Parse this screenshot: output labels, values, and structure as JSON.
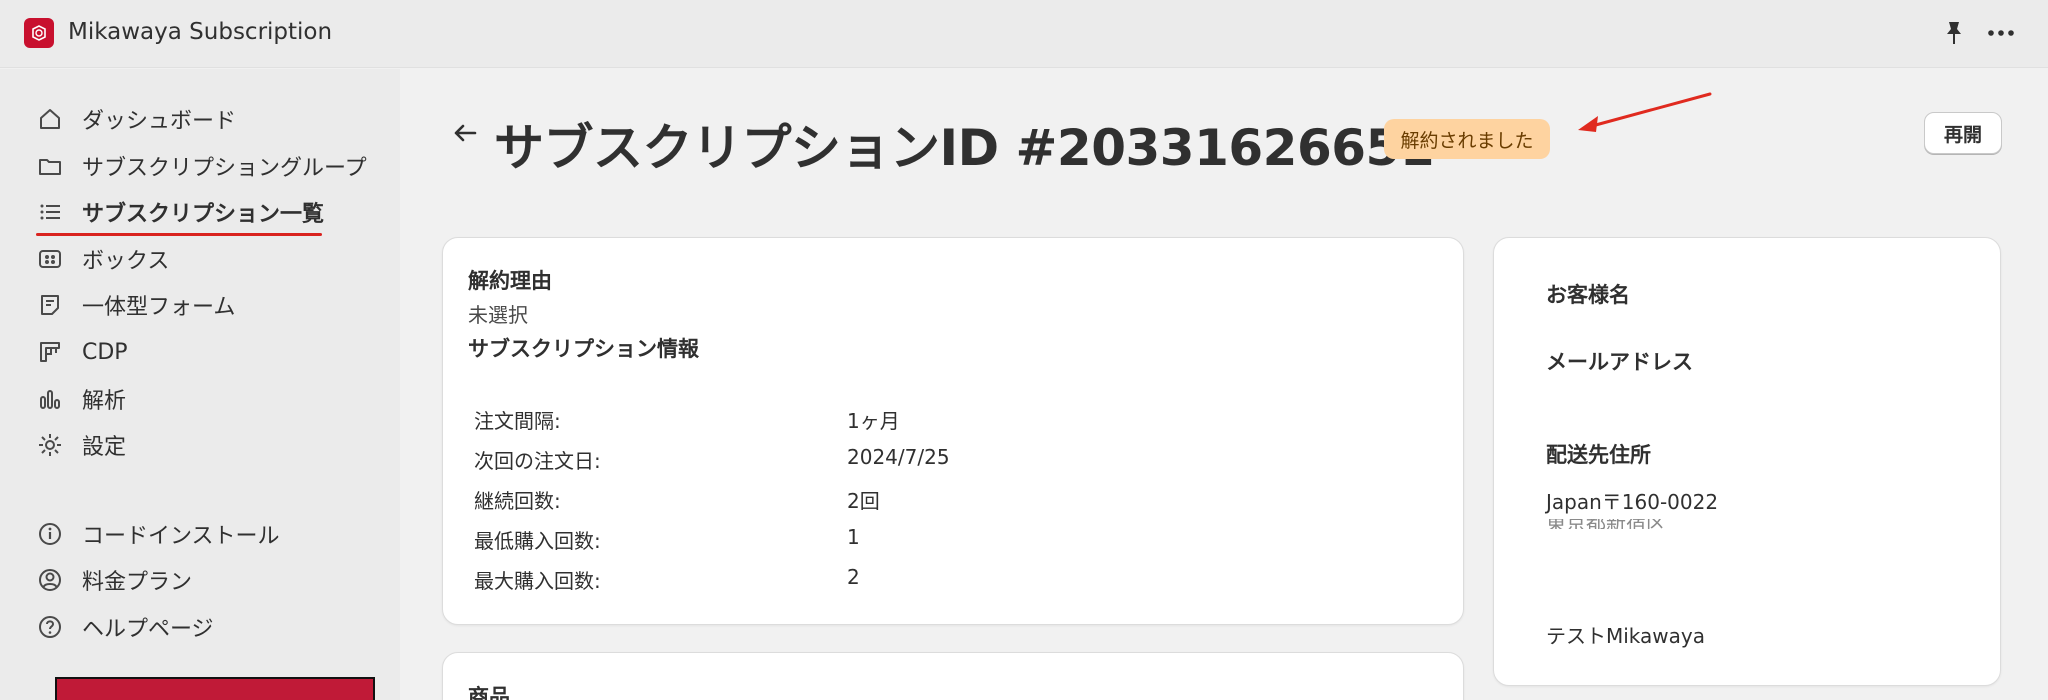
{
  "app": {
    "title": "Mikawaya Subscription",
    "brand_color": "#c8102e"
  },
  "sidebar": {
    "items": [
      {
        "label": "ダッシュボード",
        "icon": "home-icon"
      },
      {
        "label": "サブスクリプショングループ",
        "icon": "folder-icon"
      },
      {
        "label": "サブスクリプション一覧",
        "icon": "list-icon",
        "active": true
      },
      {
        "label": "ボックス",
        "icon": "box-icon"
      },
      {
        "label": "一体型フォーム",
        "icon": "form-icon"
      },
      {
        "label": "CDP",
        "icon": "grid-icon"
      },
      {
        "label": "解析",
        "icon": "bar-chart-icon"
      },
      {
        "label": "設定",
        "icon": "gear-icon"
      },
      {
        "label": "コードインストール",
        "icon": "info-icon"
      },
      {
        "label": "料金プラン",
        "icon": "person-circle-icon"
      },
      {
        "label": "ヘルプページ",
        "icon": "help-icon"
      }
    ],
    "active_underline_color": "#d9231f"
  },
  "header": {
    "title": "サブスクリプションID #20331626651",
    "status": "解約されました",
    "status_color": "#fed3a0",
    "resume_label": "再開",
    "annotation_color": "#e02a1f"
  },
  "main_card": {
    "cancel_reason_heading": "解約理由",
    "cancel_reason_value": "未選択",
    "info_heading": "サブスクリプション情報",
    "details": [
      {
        "label": "注文間隔:",
        "value": "1ヶ月"
      },
      {
        "label": "次回の注文日:",
        "value": "2024/7/25"
      },
      {
        "label": "継続回数:",
        "value": "2回"
      },
      {
        "label": "最低購入回数:",
        "value": "1"
      },
      {
        "label": "最大購入回数:",
        "value": "2"
      }
    ]
  },
  "product_card": {
    "heading": "商品"
  },
  "customer_card": {
    "name_heading": "お客様名",
    "email_heading": "メールアドレス",
    "address_heading": "配送先住所",
    "address_line1": "Japan〒160-0022",
    "address_line2_partial": "東京都新宿区",
    "customer_name_value": "テストMikawaya"
  }
}
